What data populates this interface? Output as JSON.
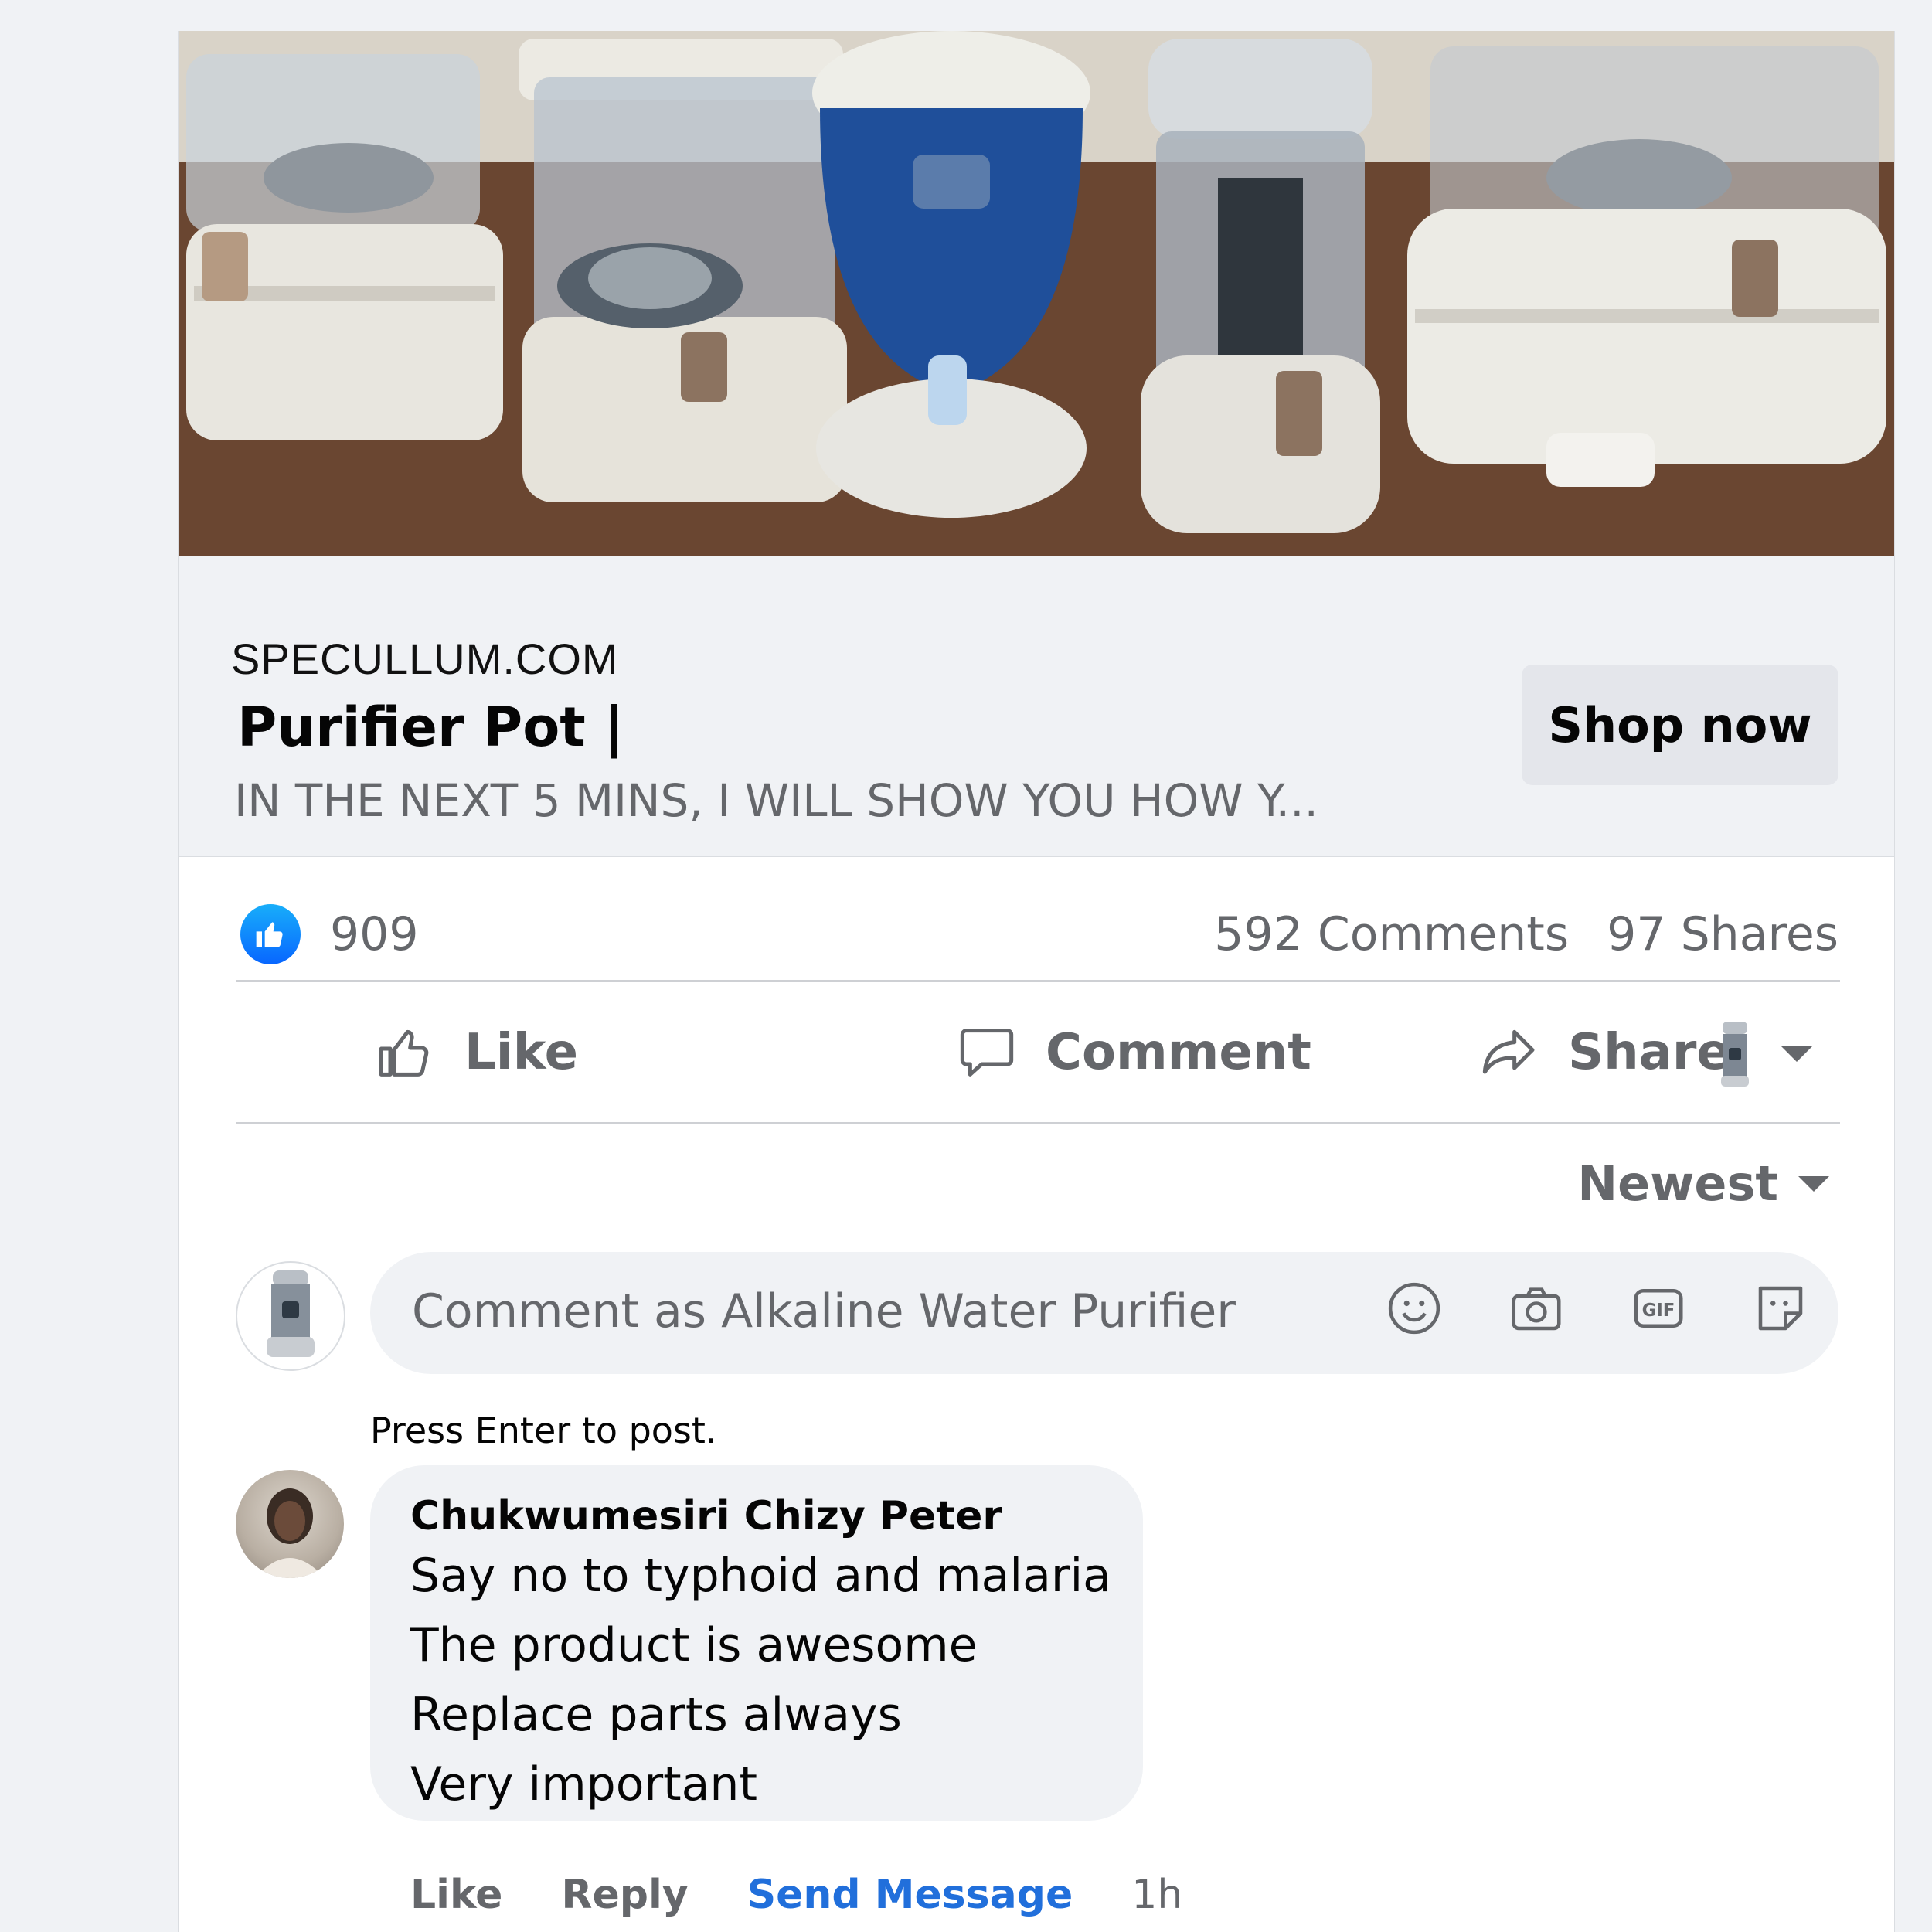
{
  "post": {
    "image_alt": "Water purifier pots on a wooden table",
    "link": {
      "domain": "SPECULLUM.COM",
      "headline": "Purifier Pot |",
      "description": "IN THE NEXT 5 MINS, I WILL SHOW YOU HOW Y...",
      "cta_label": "Shop now"
    },
    "stats": {
      "reactions": "909",
      "comments": "592 Comments",
      "shares": "97 Shares"
    },
    "actions": {
      "like": "Like",
      "comment": "Comment",
      "share": "Share"
    }
  },
  "comments": {
    "sort_label": "Newest",
    "composer_placeholder": "Comment as Alkaline Water Purifier",
    "hint": "Press Enter to post.",
    "items": [
      {
        "author": "Chukwumesiri Chizy Peter",
        "lines": [
          "Say no to typhoid and malaria",
          "The product is awesome",
          "Replace parts always",
          "Very important"
        ],
        "like": "Like",
        "reply": "Reply",
        "send_message": "Send Message",
        "time": "1h"
      }
    ]
  },
  "colors": {
    "accent": "#0866ff",
    "link": "#216fdb",
    "muted": "#65676b",
    "background": "#f0f2f5"
  },
  "icons": [
    "like-badge-icon",
    "thumbs-up-icon",
    "speech-bubble-icon",
    "share-arrow-icon",
    "chevron-down-icon",
    "emoji-icon",
    "camera-icon",
    "gif-icon",
    "sticker-icon"
  ]
}
